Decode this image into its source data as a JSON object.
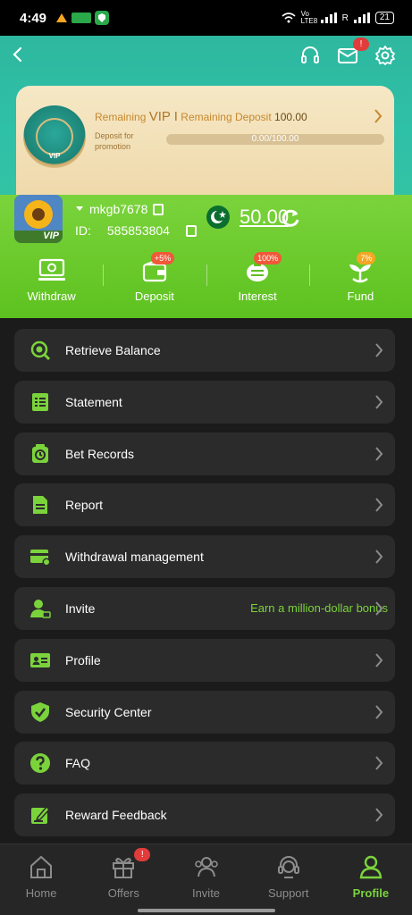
{
  "status_bar": {
    "time": "4:49",
    "battery": "21",
    "network": "Vo LTE8",
    "signal_label": "R"
  },
  "header": {
    "back": "‹",
    "mail_badge": "!"
  },
  "vip": {
    "line_prefix": "Remaining ",
    "vip_label": "VIP I",
    "deposit_label": " Remaining Deposit ",
    "amount": "100.00",
    "sub": "Deposit for promotion",
    "progress_text": "0.00/100.00",
    "medal_label": "VIP"
  },
  "user": {
    "username": "mkgb7678",
    "id_label": "ID:",
    "id": "585853804",
    "balance": "50.00",
    "avatar_badge": "VIP"
  },
  "quick_actions": [
    {
      "label": "Withdraw",
      "badge": ""
    },
    {
      "label": "Deposit",
      "badge": "+5%"
    },
    {
      "label": "Interest",
      "badge": "100%"
    },
    {
      "label": "Fund",
      "badge": "7%"
    }
  ],
  "menu": [
    {
      "label": "Retrieve Balance",
      "extra": ""
    },
    {
      "label": "Statement",
      "extra": ""
    },
    {
      "label": "Bet Records",
      "extra": ""
    },
    {
      "label": "Report",
      "extra": ""
    },
    {
      "label": "Withdrawal management",
      "extra": ""
    },
    {
      "label": "Invite",
      "extra": "Earn a million-dollar bonus"
    },
    {
      "label": "Profile",
      "extra": ""
    },
    {
      "label": "Security Center",
      "extra": ""
    },
    {
      "label": "FAQ",
      "extra": ""
    },
    {
      "label": "Reward Feedback",
      "extra": ""
    }
  ],
  "nav": [
    {
      "label": "Home"
    },
    {
      "label": "Offers",
      "badge": "!"
    },
    {
      "label": "Invite"
    },
    {
      "label": "Support"
    },
    {
      "label": "Profile"
    }
  ],
  "colors": {
    "accent": "#7bd33c",
    "teal": "#2eb89f",
    "card_bg": "#2b2b2b",
    "page_bg": "#1b1b1b"
  }
}
